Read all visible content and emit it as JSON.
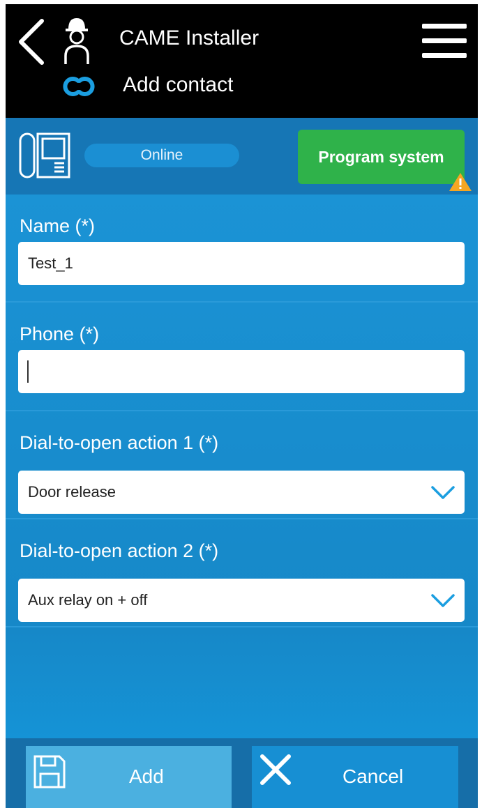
{
  "header": {
    "app_title": "CAME Installer",
    "page_title": "Add contact"
  },
  "status": {
    "connection": "Online",
    "program_button": "Program system"
  },
  "form": {
    "name": {
      "label": "Name (*)",
      "value": "Test_1"
    },
    "phone": {
      "label": "Phone (*)",
      "value": ""
    },
    "action1": {
      "label": "Dial-to-open action 1 (*)",
      "value": "Door release"
    },
    "action2": {
      "label": "Dial-to-open action 2 (*)",
      "value": "Aux relay on + off"
    }
  },
  "footer": {
    "add_label": "Add",
    "cancel_label": "Cancel"
  },
  "icons": {
    "back": "back-arrow-icon",
    "installer": "installer-person-icon",
    "link": "link-icon",
    "menu": "hamburger-menu-icon",
    "device": "intercom-device-icon",
    "warning": "warning-icon",
    "chevron": "chevron-down-icon",
    "save": "save-icon",
    "close": "close-icon"
  },
  "colors": {
    "accent": "#1a8fd0",
    "header": "#000000",
    "program_button": "#2fb24a",
    "warning": "#f5a623"
  }
}
